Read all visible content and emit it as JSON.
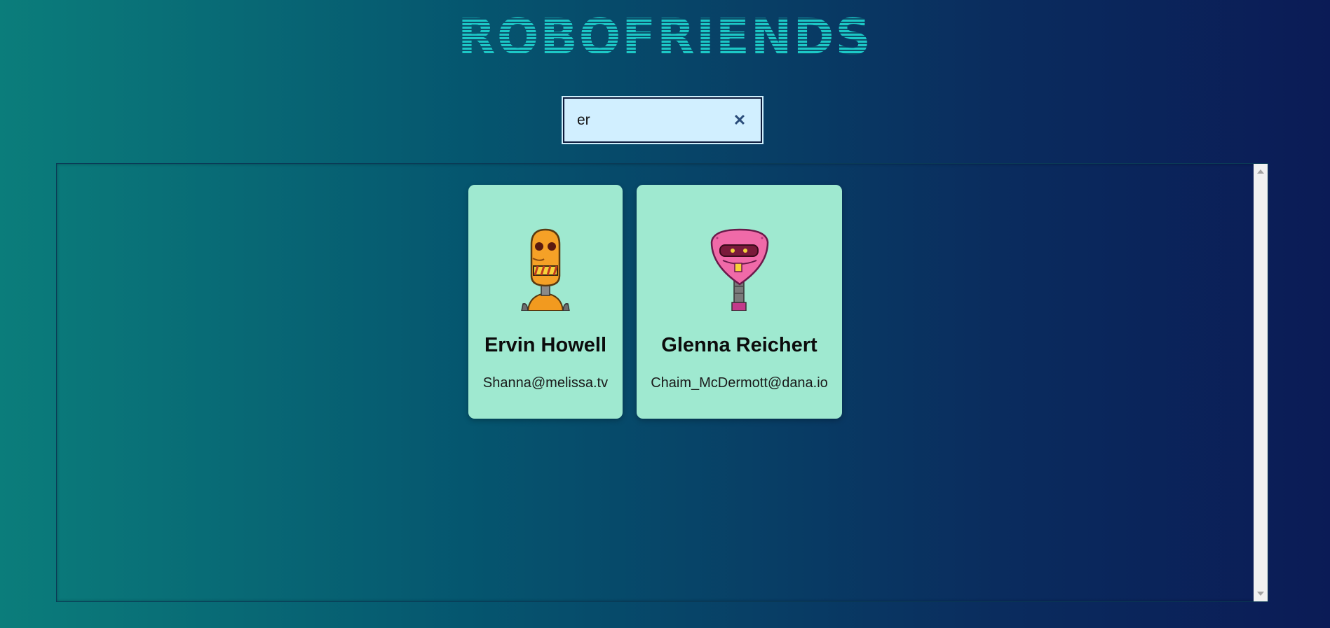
{
  "app": {
    "title": "ROBOFRIENDS"
  },
  "search": {
    "value": "er",
    "clear_icon": "close-icon",
    "clear_glyph": "✕"
  },
  "cards": [
    {
      "name": "Ervin Howell",
      "email": "Shanna@melissa.tv",
      "avatar_icon": "orange-robot-avatar"
    },
    {
      "name": "Glenna Reichert",
      "email": "Chaim_McDermott@dana.io",
      "avatar_icon": "pink-robot-avatar"
    }
  ],
  "colors": {
    "card_background": "#9fe9d0",
    "title_color": "#1cc8c7",
    "search_background": "#d1efff"
  }
}
